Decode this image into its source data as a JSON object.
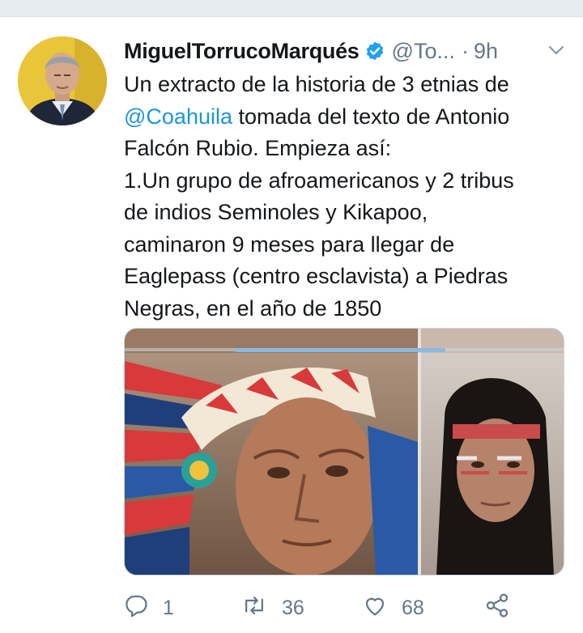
{
  "tweet": {
    "author_name": "MiguelTorrucoMarqués",
    "handle": "@To...",
    "separator": "·",
    "time": "9h",
    "text_lines": [
      "Un extracto de la historia de 3 etnias de",
      "tomada del texto de Antonio",
      "Falcón  Rubio. Empieza así:",
      "1.Un grupo de afroamericanos y 2 tribus",
      "de indios Seminoles y Kikapoo,",
      "caminaron 9 meses para llegar de",
      "Eaglepass (centro esclavista) a Piedras",
      "Negras, en el año de 1850"
    ],
    "mention": "@Coahuila",
    "media_progress": 0.48
  },
  "actions": {
    "reply_count": "1",
    "retweet_count": "36",
    "like_count": "68"
  },
  "icons": {
    "verified": "verified-badge-icon",
    "chevron": "chevron-down-icon",
    "reply": "reply-icon",
    "retweet": "retweet-icon",
    "like": "heart-icon",
    "share": "share-icon"
  },
  "colors": {
    "accent": "#1da1f2",
    "link": "#1b95e0",
    "muted": "#657786"
  }
}
